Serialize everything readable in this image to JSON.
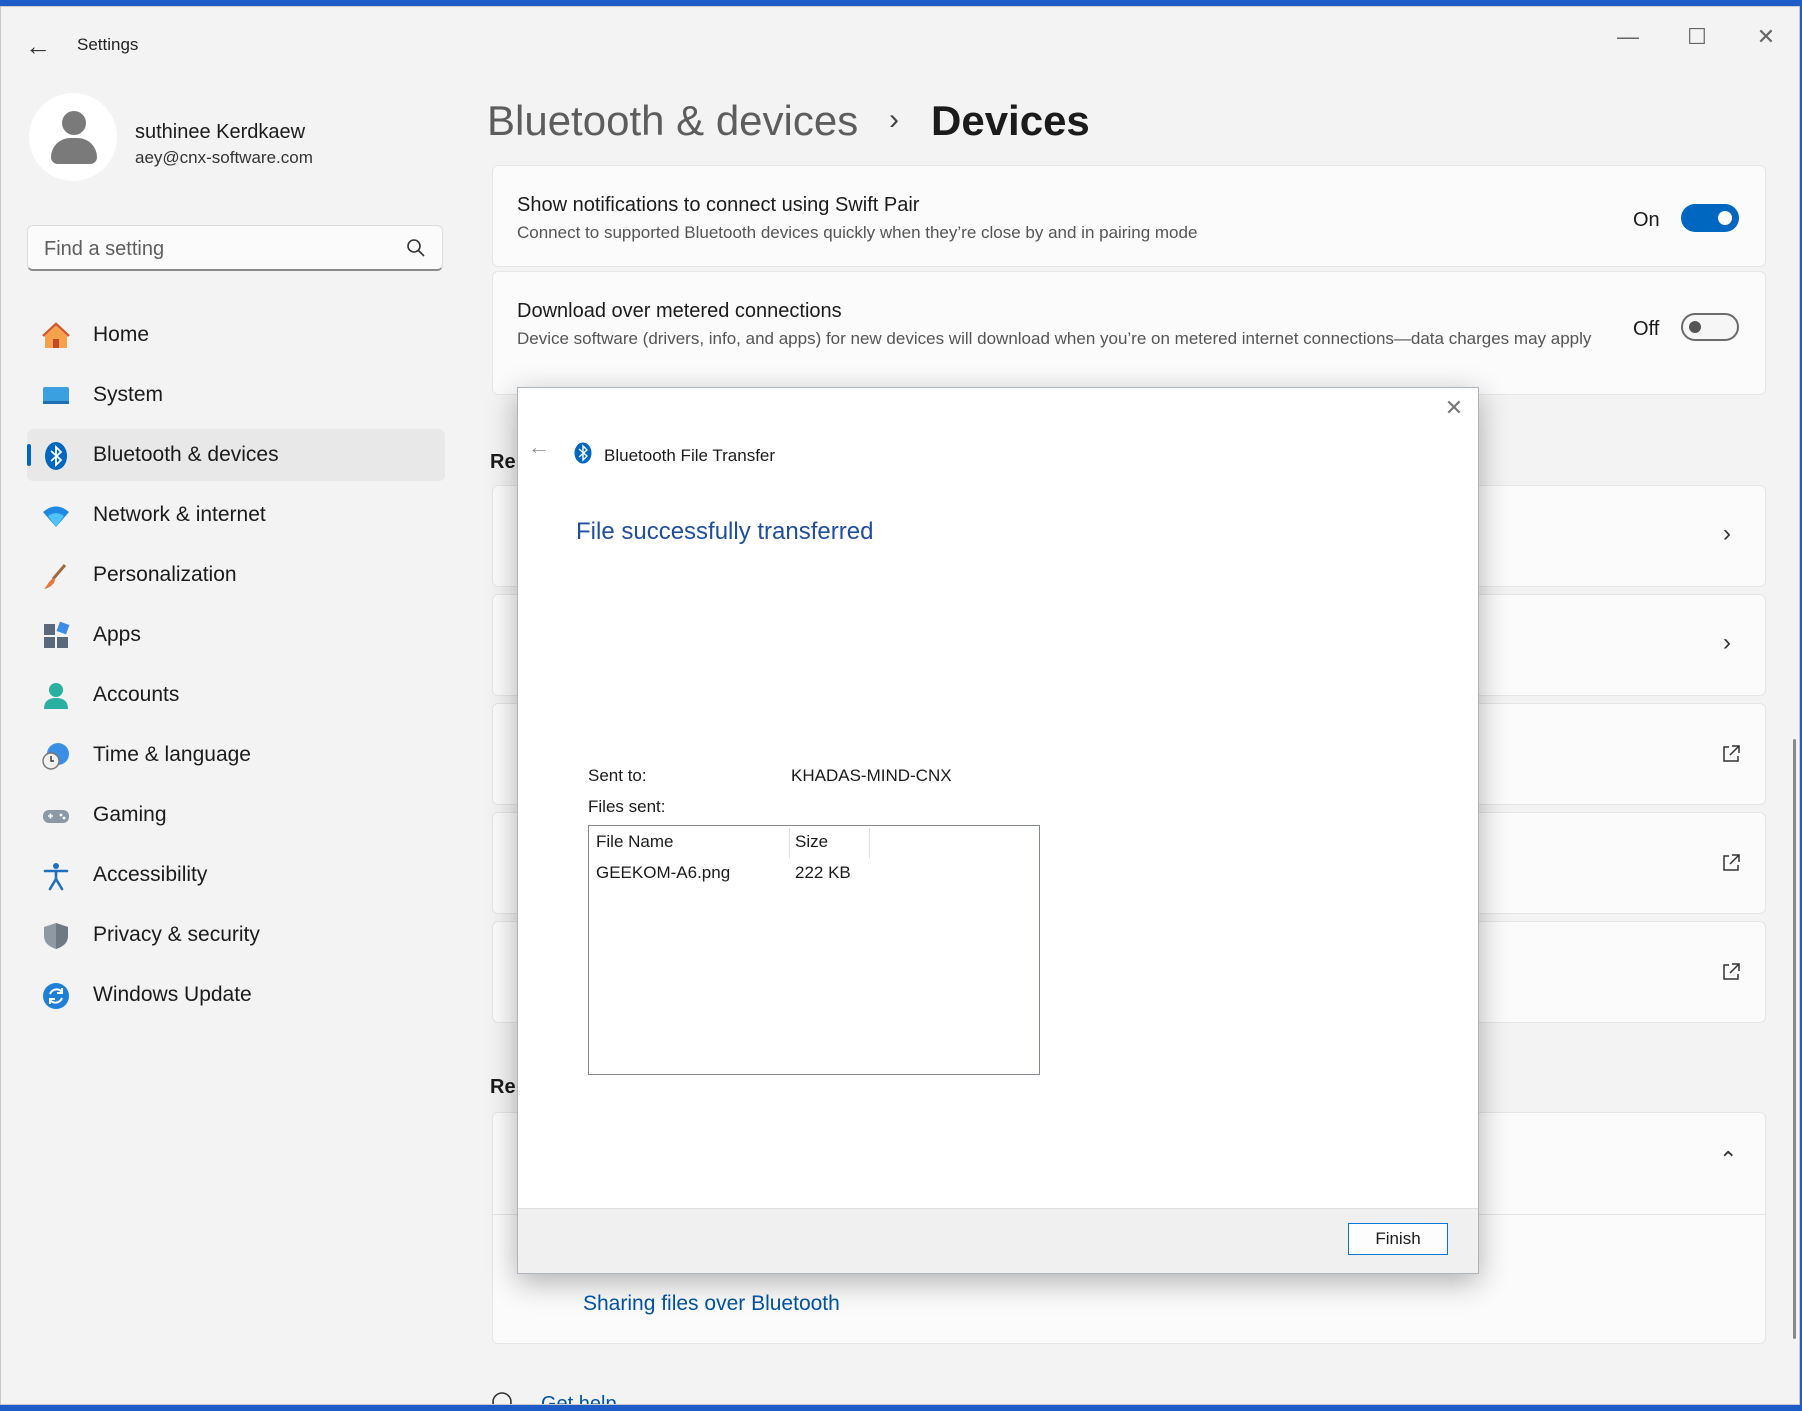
{
  "window": {
    "title": "Settings"
  },
  "profile": {
    "name": "suthinee Kerdkaew",
    "email": "aey@cnx-software.com"
  },
  "search": {
    "placeholder": "Find a setting"
  },
  "nav": [
    {
      "label": "Home",
      "icon": "home-icon"
    },
    {
      "label": "System",
      "icon": "system-icon"
    },
    {
      "label": "Bluetooth & devices",
      "icon": "bluetooth-icon",
      "selected": true
    },
    {
      "label": "Network & internet",
      "icon": "wifi-icon"
    },
    {
      "label": "Personalization",
      "icon": "brush-icon"
    },
    {
      "label": "Apps",
      "icon": "apps-icon"
    },
    {
      "label": "Accounts",
      "icon": "accounts-icon"
    },
    {
      "label": "Time & language",
      "icon": "clock-icon"
    },
    {
      "label": "Gaming",
      "icon": "gamepad-icon"
    },
    {
      "label": "Accessibility",
      "icon": "accessibility-icon"
    },
    {
      "label": "Privacy & security",
      "icon": "shield-icon"
    },
    {
      "label": "Windows Update",
      "icon": "update-icon"
    }
  ],
  "breadcrumb": {
    "parent": "Bluetooth & devices",
    "sep": "›",
    "current": "Devices"
  },
  "settings": {
    "swift_pair": {
      "title": "Show notifications to connect using Swift Pair",
      "desc": "Connect to supported Bluetooth devices quickly when they’re close by and in pairing mode",
      "state_label": "On"
    },
    "metered": {
      "title": "Download over metered connections",
      "desc": "Device software (drivers, info, and apps) for new devices will download when you’re on metered internet connections—data charges may apply",
      "state_label": "Off"
    }
  },
  "partial": {
    "related_1": "Rel",
    "related_2": "Rel",
    "get_help": "Get help"
  },
  "help_link": "Sharing files over Bluetooth",
  "dialog": {
    "title": "Bluetooth File Transfer",
    "heading": "File successfully transferred",
    "sent_to_label": "Sent to:",
    "sent_to_value": "KHADAS-MIND-CNX",
    "files_sent_label": "Files sent:",
    "columns": [
      "File Name",
      "Size"
    ],
    "rows": [
      {
        "name": "GEEKOM-A6.png",
        "size": "222 KB"
      }
    ],
    "finish": "Finish",
    "close": "✕",
    "back": "←"
  },
  "colors": {
    "accent": "#0067c0",
    "dialog_heading": "#1f4e9e",
    "link": "#0054a6"
  }
}
